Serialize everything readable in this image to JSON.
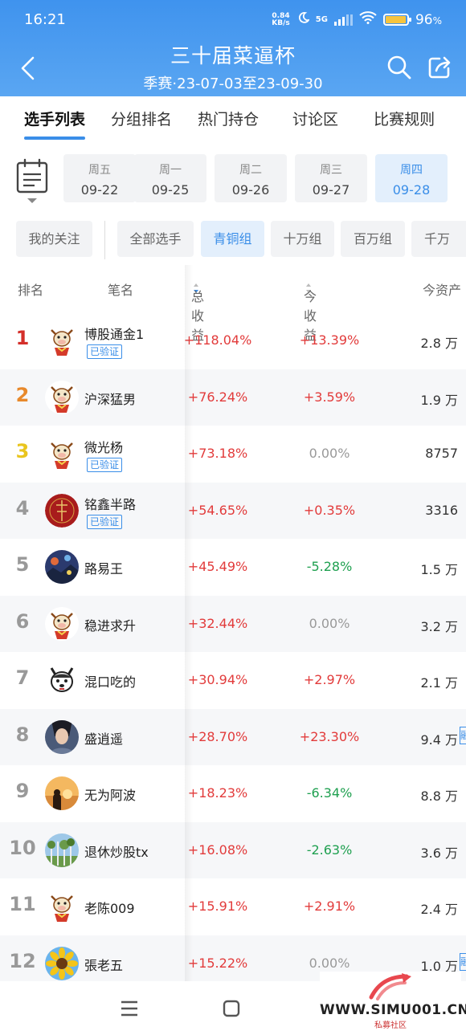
{
  "status_bar": {
    "time": "16:21",
    "net_speed_value": "0.84",
    "net_speed_unit": "KB/s",
    "network": "5G",
    "battery": "96",
    "battery_unit": "%"
  },
  "header": {
    "title": "三十届菜逼杯",
    "subtitle": "季赛·23-07-03至23-09-30"
  },
  "tabs": [
    {
      "label": "选手列表",
      "active": true
    },
    {
      "label": "分组排名"
    },
    {
      "label": "热门持仓"
    },
    {
      "label": "讨论区"
    },
    {
      "label": "比赛规则"
    }
  ],
  "dates": [
    {
      "weekday": "周五",
      "date": "09-22"
    },
    {
      "weekday": "周一",
      "date": "09-25"
    },
    {
      "weekday": "周二",
      "date": "09-26"
    },
    {
      "weekday": "周三",
      "date": "09-27"
    },
    {
      "weekday": "周四",
      "date": "09-28",
      "selected": true
    }
  ],
  "filters": {
    "follow": "我的关注",
    "groups": [
      {
        "label": "全部选手"
      },
      {
        "label": "青铜组",
        "selected": true
      },
      {
        "label": "十万组"
      },
      {
        "label": "百万组"
      },
      {
        "label": "千万"
      }
    ]
  },
  "columns": {
    "rank": "排名",
    "name": "笔名",
    "total": "总收益",
    "today": "今收益",
    "assets": "今资产"
  },
  "verified_label": "已验证",
  "margin_label": "融",
  "rows": [
    {
      "rank": "1",
      "name": "博股通金1",
      "verified": true,
      "total": "+118.04%",
      "today": "+13.39%",
      "assets": "2.8 万",
      "avatar": "cow"
    },
    {
      "rank": "2",
      "name": "沪深猛男",
      "total": "+76.24%",
      "today": "+3.59%",
      "assets": "1.9 万",
      "avatar": "cow"
    },
    {
      "rank": "3",
      "name": "微光杨",
      "verified": true,
      "total": "+73.18%",
      "today": "0.00%",
      "assets": "8757",
      "avatar": "cow"
    },
    {
      "rank": "4",
      "name": "铭鑫半路",
      "verified": true,
      "total": "+54.65%",
      "today": "+0.35%",
      "assets": "3316",
      "avatar": "red"
    },
    {
      "rank": "5",
      "name": "路易王",
      "total": "+45.49%",
      "today": "-5.28%",
      "assets": "1.5 万",
      "avatar": "photo"
    },
    {
      "rank": "6",
      "name": "稳进求升",
      "total": "+32.44%",
      "today": "0.00%",
      "assets": "3.2 万",
      "avatar": "cow"
    },
    {
      "rank": "7",
      "name": "混口吃的",
      "total": "+30.94%",
      "today": "+2.97%",
      "assets": "2.1 万",
      "avatar": "dog"
    },
    {
      "rank": "8",
      "name": "盛逍遥",
      "total": "+28.70%",
      "today": "+23.30%",
      "assets": "9.4 万",
      "margin": true,
      "avatar": "person"
    },
    {
      "rank": "9",
      "name": "无为阿波",
      "total": "+18.23%",
      "today": "-6.34%",
      "assets": "8.8 万",
      "avatar": "sunset"
    },
    {
      "rank": "10",
      "name": "退休炒股tx",
      "total": "+16.08%",
      "today": "-2.63%",
      "assets": "3.6 万",
      "avatar": "trees"
    },
    {
      "rank": "11",
      "name": "老陈009",
      "total": "+15.91%",
      "today": "+2.91%",
      "assets": "2.4 万",
      "avatar": "cow"
    },
    {
      "rank": "12",
      "name": "張老五",
      "total": "+15.22%",
      "today": "0.00%",
      "assets": "1.0 万",
      "margin": true,
      "avatar": "sunflower"
    }
  ],
  "watermark": {
    "site": "WWW.SIMU001.CN",
    "caption": "私募社区"
  },
  "colors": {
    "header_blue": "#4a9bf0",
    "accent": "#3a8ee8",
    "gain": "#e23b3b",
    "loss": "#1fa050"
  }
}
